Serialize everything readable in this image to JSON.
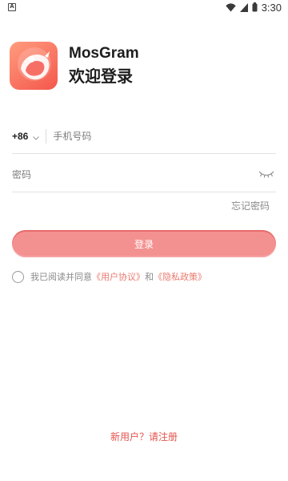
{
  "status_bar": {
    "notification_icon": "app-notification-icon",
    "time": "3:30",
    "icons": [
      "wifi-icon",
      "signal-icon",
      "battery-icon"
    ]
  },
  "header": {
    "app_name": "MosGram",
    "welcome": "欢迎登录",
    "logo_icon": "app-logo-icon"
  },
  "login_form": {
    "country_code": "+86",
    "phone_placeholder": "手机号码",
    "phone_value": "",
    "password_placeholder": "密码",
    "password_value": "",
    "forgot_password": "忘记密码",
    "login_button": "登录"
  },
  "agreement": {
    "prefix": "我已阅读并同意",
    "user_agreement": "《用户协议》",
    "and": "和",
    "privacy_policy": "《隐私政策》",
    "checked": false
  },
  "footer": {
    "register_link": "新用户？请注册"
  },
  "colors": {
    "accent": "#e3544d",
    "button": "#f39190",
    "link": "#e87a6e",
    "logo_gradient_start": "#ff9c7e",
    "logo_gradient_end": "#f4574c"
  }
}
